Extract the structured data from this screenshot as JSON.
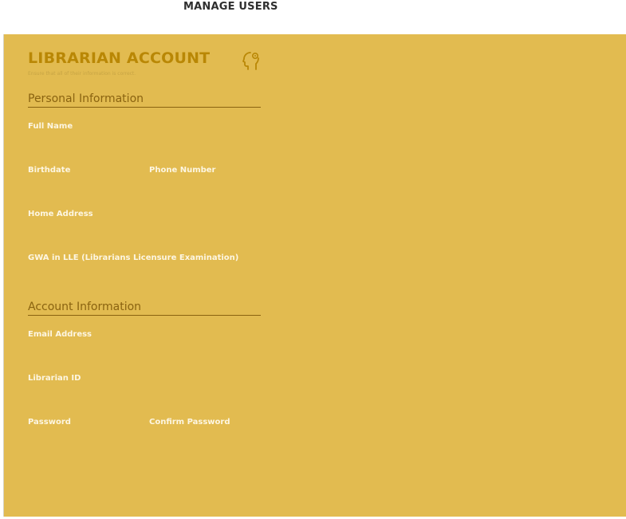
{
  "header": {
    "title": "MANAGE USERS"
  },
  "form": {
    "title": "LIBRARIAN ACCOUNT",
    "subtitle": "Ensure that all of their information is correct.",
    "icon": "head-gear-icon",
    "personal": {
      "heading": "Personal Information",
      "full_name": "Full Name",
      "birthdate": "Birthdate",
      "phone": "Phone Number",
      "address": "Home Address",
      "gwa": "GWA in LLE (Librarians Licensure Examination)"
    },
    "account": {
      "heading": "Account Information",
      "email": "Email Address",
      "librarian_id": "Librarian ID",
      "password": "Password",
      "confirm_password": "Confirm Password"
    }
  },
  "colors": {
    "panel": "#e2bb50",
    "title": "#b98705",
    "section": "#8a6310",
    "label": "#fdf6e2"
  }
}
